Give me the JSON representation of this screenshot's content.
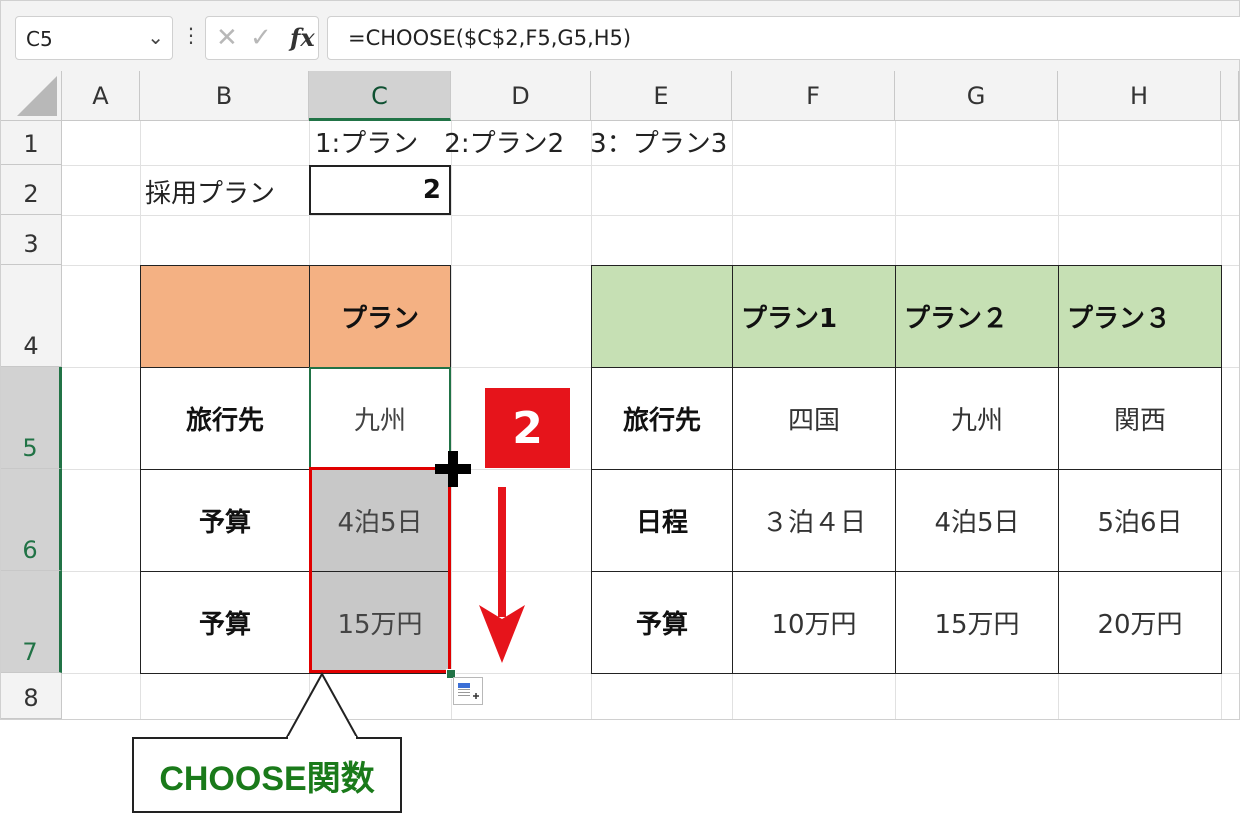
{
  "formula_bar": {
    "name_box": "C5",
    "formula": "=CHOOSE($C$2,F5,G5,H5)",
    "fx_label": "fx"
  },
  "columns": [
    "A",
    "B",
    "C",
    "D",
    "E",
    "F",
    "G",
    "H"
  ],
  "rows": [
    "1",
    "2",
    "3",
    "4",
    "5",
    "6",
    "7",
    "8"
  ],
  "row1_note": "1:プラン　2:プラン2　3：プラン3",
  "adopted_plan": {
    "label": "採用プラン",
    "value": "2"
  },
  "left_table": {
    "header": "プラン",
    "rows": [
      {
        "label": "旅行先",
        "value": "九州"
      },
      {
        "label": "予算",
        "value": "4泊5日"
      },
      {
        "label": "予算",
        "value": "15万円"
      }
    ]
  },
  "right_table": {
    "headers": [
      "プラン1",
      "プラン２",
      "プラン３"
    ],
    "rows": [
      {
        "label": "旅行先",
        "values": [
          "四国",
          "九州",
          "関西"
        ]
      },
      {
        "label": "日程",
        "values": [
          "３泊４日",
          "4泊5日",
          "5泊6日"
        ]
      },
      {
        "label": "予算",
        "values": [
          "10万円",
          "15万円",
          "20万円"
        ]
      }
    ]
  },
  "badge": "2",
  "callout": "CHOOSE関数",
  "colors": {
    "accent_green": "#217346",
    "highlight_red": "#e00000",
    "orange_header": "#f4b183",
    "green_header": "#c6e0b4"
  }
}
